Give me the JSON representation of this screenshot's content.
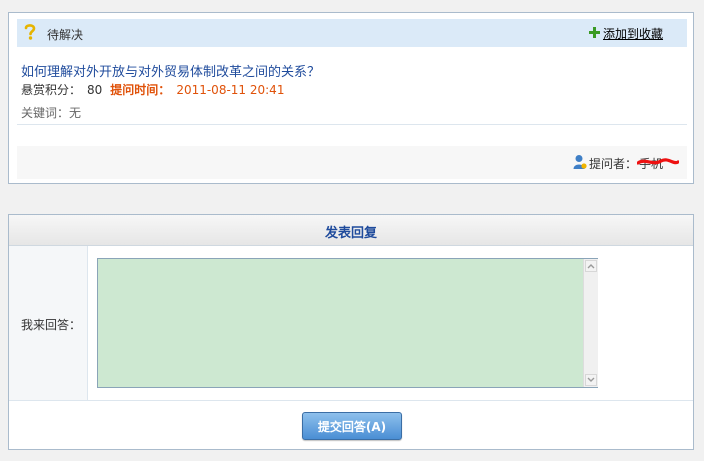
{
  "question": {
    "status": "待解决",
    "favorite_label": "添加到收藏",
    "title": "如何理解对外开放与对外贸易体制改革之间的关系？",
    "reward_label": "悬赏积分：",
    "reward_points": "80",
    "ask_time_label": "提问时间：",
    "ask_time": "2011-08-11 20:41",
    "keywords": "关键词：无",
    "asker_label": "提问者：",
    "asker_name": "手机"
  },
  "reply": {
    "title": "发表回复",
    "answer_label": "我来回答：",
    "answer_value": "",
    "submit_label": "提交回答(A)"
  },
  "colors": {
    "accent": "#1f4b9c",
    "ask_time": "#e0520a",
    "textarea_bg": "#cde8d1",
    "status_bar_bg": "#dbeaf8"
  },
  "icons": {
    "status": "question-mark-icon",
    "favorite": "green-plus-icon",
    "asker": "user-icon"
  }
}
